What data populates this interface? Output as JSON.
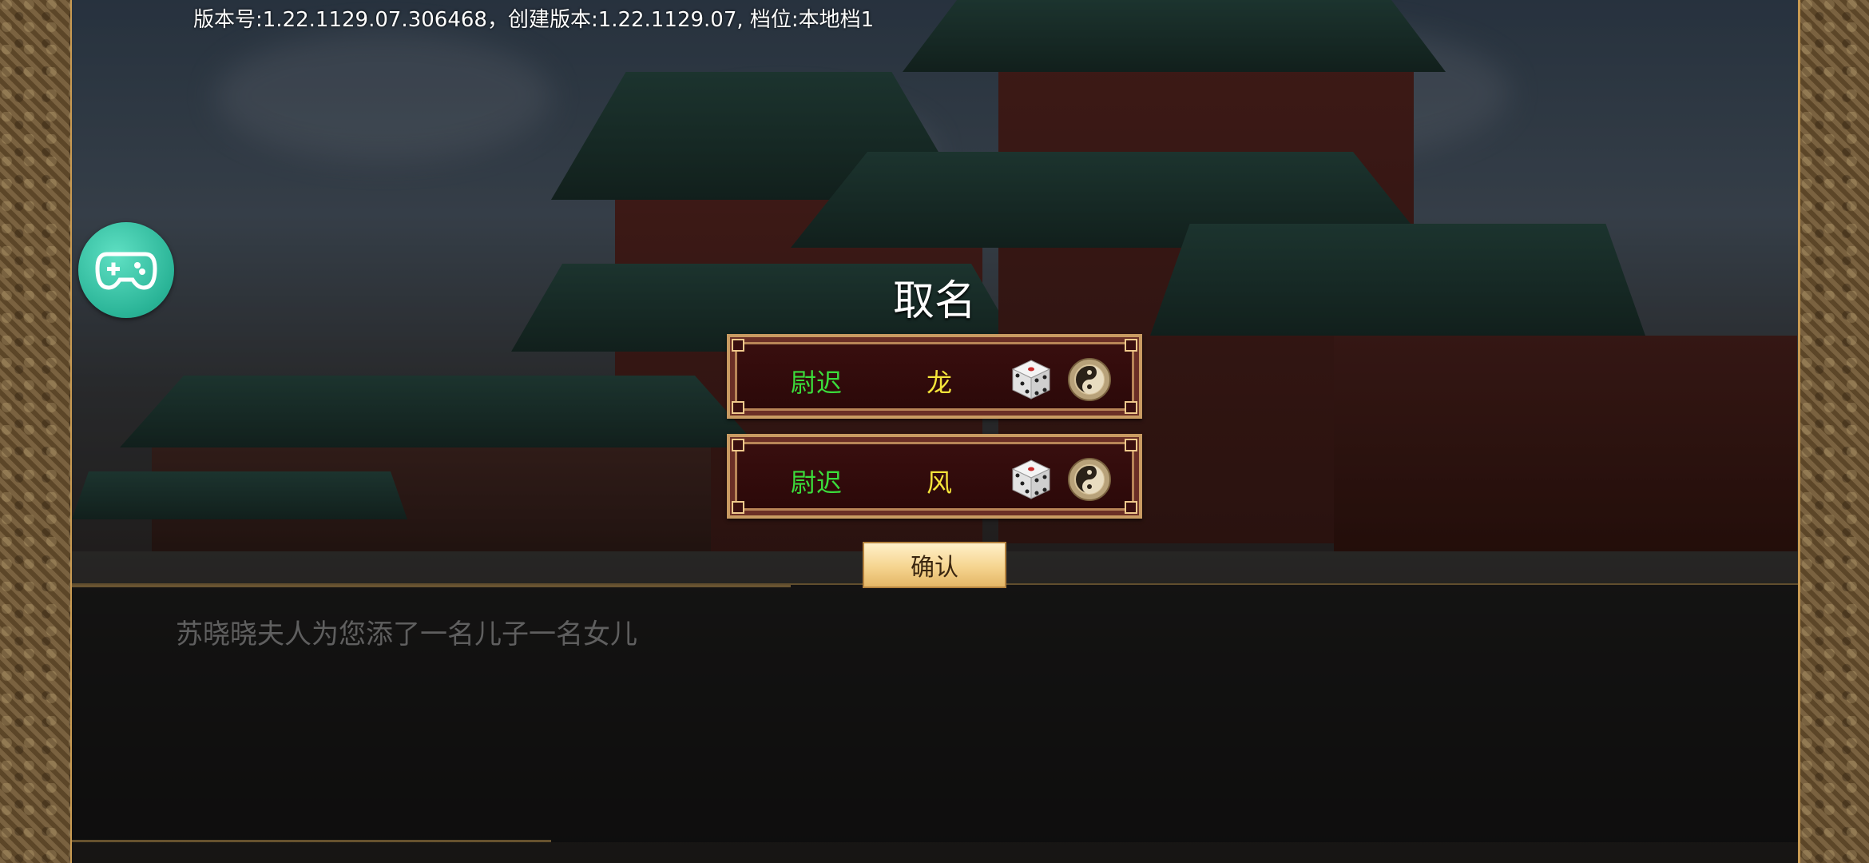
{
  "header": {
    "version_info": "版本号:1.22.1129.07.306468，创建版本:1.22.1129.07, 档位:本地档1"
  },
  "floating_button": {
    "icon": "gamepad-icon",
    "color": "#2ab497"
  },
  "naming_dialog": {
    "title": "取名",
    "options": [
      {
        "surname": "尉迟",
        "given_name": "龙",
        "surname_color": "#3bdc3b",
        "given_name_color": "#f5e53a"
      },
      {
        "surname": "尉迟",
        "given_name": "风",
        "surname_color": "#3bdc3b",
        "given_name_color": "#f5e53a"
      }
    ],
    "icons": [
      "dice-icon",
      "yinyang-icon"
    ],
    "confirm_label": "确认"
  },
  "message": {
    "text": "苏晓晓夫人为您添了一名儿子一名女儿"
  }
}
